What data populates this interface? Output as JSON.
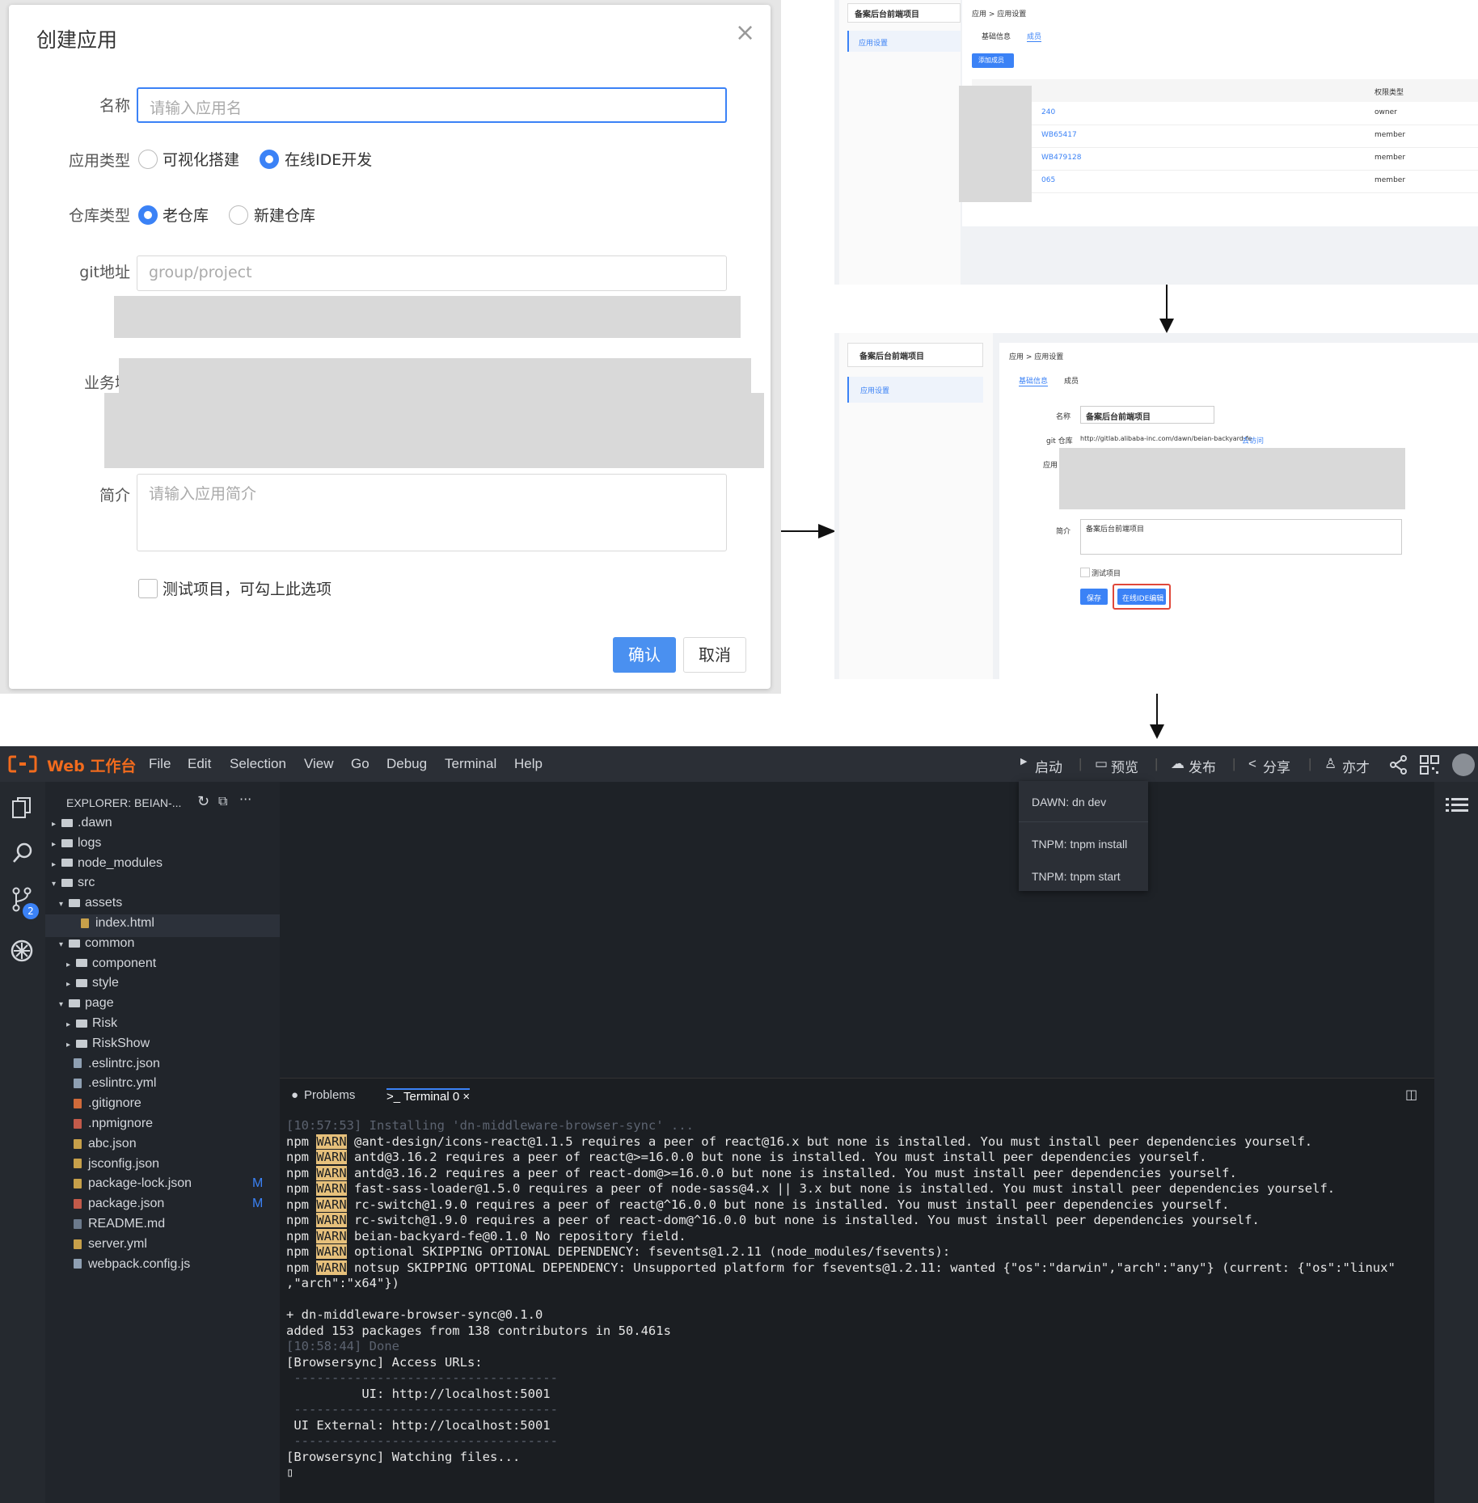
{
  "dialog": {
    "title": "创建应用",
    "close_glyph": "×",
    "name_label": "名称",
    "name_placeholder": "请输入应用名",
    "apptype_label": "应用类型",
    "apptype_options": [
      "可视化搭建",
      "在线IDE开发"
    ],
    "apptype_selected": "在线IDE开发",
    "repotype_label": "仓库类型",
    "repotype_options": [
      "老仓库",
      "新建仓库"
    ],
    "repotype_selected": "老仓库",
    "git_label": "git地址",
    "git_placeholder": "group/project",
    "domain_label": "业务域",
    "intro_label": "简介",
    "intro_placeholder": "请输入应用简介",
    "test_checkbox_label": "测试项目，可勾上此选项",
    "confirm_label": "确认",
    "cancel_label": "取消"
  },
  "shot_members": {
    "project_select": "备案后台前端项目",
    "sidebar_item": "应用设置",
    "breadcrumb": "应用 > 应用设置",
    "tabs": [
      "基础信息",
      "成员"
    ],
    "add_member_button": "添加成员",
    "table_header_role": "权限类型",
    "rows": [
      {
        "name": "240",
        "role": "owner"
      },
      {
        "name": "WB65417",
        "role": "member"
      },
      {
        "name": "WB479128",
        "role": "member"
      },
      {
        "name": "065",
        "role": "member"
      }
    ]
  },
  "shot_settings": {
    "project_select": "备案后台前端项目",
    "sidebar_item": "应用设置",
    "breadcrumb": "应用 > 应用设置",
    "tabs": [
      "基础信息",
      "成员"
    ],
    "name_label": "名称",
    "name_value": "备案后台前端项目",
    "git_label": "git 仓库",
    "git_value": "http://gitlab.alibaba-inc.com/dawn/beian-backyard-fe",
    "git_link": "去访问",
    "app_label": "应用",
    "intro_label": "简介",
    "intro_value": "备案后台前端项目",
    "test_label": "测试项目",
    "save_button": "保存",
    "ide_button": "在线IDE编辑"
  },
  "ide": {
    "brand": "Web 工作台",
    "menus": [
      "File",
      "Edit",
      "Selection",
      "View",
      "Go",
      "Debug",
      "Terminal",
      "Help"
    ],
    "toolbar": {
      "start": "启动",
      "preview": "预览",
      "publish": "发布",
      "share": "分享",
      "user": "亦才"
    },
    "explorer_title": "EXPLORER: BEIAN-...",
    "scm_badge": "2",
    "tree": [
      {
        "name": ".dawn",
        "type": "folder",
        "level": 0,
        "open": false
      },
      {
        "name": "logs",
        "type": "folder",
        "level": 0,
        "open": false
      },
      {
        "name": "node_modules",
        "type": "folder",
        "level": 0,
        "open": false
      },
      {
        "name": "src",
        "type": "folder",
        "level": 0,
        "open": true
      },
      {
        "name": "assets",
        "type": "folder",
        "level": 1,
        "open": true
      },
      {
        "name": "index.html",
        "type": "file",
        "level": 2,
        "open": false
      },
      {
        "name": "common",
        "type": "folder",
        "level": 1,
        "open": true
      },
      {
        "name": "component",
        "type": "folder",
        "level": 2,
        "open": false
      },
      {
        "name": "style",
        "type": "folder",
        "level": 2,
        "open": false
      },
      {
        "name": "page",
        "type": "folder",
        "level": 1,
        "open": true
      },
      {
        "name": "Risk",
        "type": "folder",
        "level": 2,
        "open": false
      },
      {
        "name": "RiskShow",
        "type": "folder",
        "level": 2,
        "open": false
      },
      {
        "name": ".eslintrc.json",
        "type": "file",
        "level": 1,
        "open": false
      },
      {
        "name": ".eslintrc.yml",
        "type": "file",
        "level": 1,
        "open": false
      },
      {
        "name": ".gitignore",
        "type": "file",
        "level": 1,
        "open": false
      },
      {
        "name": ".npmignore",
        "type": "file",
        "level": 1,
        "open": false
      },
      {
        "name": "abc.json",
        "type": "file",
        "level": 1,
        "open": false
      },
      {
        "name": "jsconfig.json",
        "type": "file",
        "level": 1,
        "open": false
      },
      {
        "name": "package-lock.json",
        "type": "file",
        "level": 1,
        "open": false,
        "status": "M"
      },
      {
        "name": "package.json",
        "type": "file",
        "level": 1,
        "open": false,
        "status": "M"
      },
      {
        "name": "README.md",
        "type": "file",
        "level": 1,
        "open": false
      },
      {
        "name": "server.yml",
        "type": "file",
        "level": 1,
        "open": false
      },
      {
        "name": "webpack.config.js",
        "type": "file",
        "level": 1,
        "open": false
      }
    ],
    "dropdown": [
      "DAWN: dn dev",
      "TNPM: tnpm install",
      "TNPM: tnpm start"
    ],
    "panel_tabs": {
      "problems": "Problems",
      "terminal": ">_ Terminal 0 ×"
    },
    "terminal_lines": [
      {
        "kind": "dim",
        "text": "[10:57:53] Installing 'dn-middleware-browser-sync' ..."
      },
      {
        "kind": "warn",
        "prefix": "npm ",
        "tag": "WARN",
        "text": " @ant-design/icons-react@1.1.5 requires a peer of react@16.x but none is installed. You must install peer dependencies yourself."
      },
      {
        "kind": "warn",
        "prefix": "npm ",
        "tag": "WARN",
        "text": " antd@3.16.2 requires a peer of react@>=16.0.0 but none is installed. You must install peer dependencies yourself."
      },
      {
        "kind": "warn",
        "prefix": "npm ",
        "tag": "WARN",
        "text": " antd@3.16.2 requires a peer of react-dom@>=16.0.0 but none is installed. You must install peer dependencies yourself."
      },
      {
        "kind": "warn",
        "prefix": "npm ",
        "tag": "WARN",
        "text": " fast-sass-loader@1.5.0 requires a peer of node-sass@4.x || 3.x but none is installed. You must install peer dependencies yourself."
      },
      {
        "kind": "warn",
        "prefix": "npm ",
        "tag": "WARN",
        "text": " rc-switch@1.9.0 requires a peer of react@^16.0.0 but none is installed. You must install peer dependencies yourself."
      },
      {
        "kind": "warn",
        "prefix": "npm ",
        "tag": "WARN",
        "text": " rc-switch@1.9.0 requires a peer of react-dom@^16.0.0 but none is installed. You must install peer dependencies yourself."
      },
      {
        "kind": "warn",
        "prefix": "npm ",
        "tag": "WARN",
        "text": " beian-backyard-fe@0.1.0 No repository field."
      },
      {
        "kind": "warn",
        "prefix": "npm ",
        "tag": "WARN",
        "text": " optional SKIPPING OPTIONAL DEPENDENCY: fsevents@1.2.11 (node_modules/fsevents):"
      },
      {
        "kind": "warn",
        "prefix": "npm ",
        "tag": "WARN",
        "text": " notsup SKIPPING OPTIONAL DEPENDENCY: Unsupported platform for fsevents@1.2.11: wanted {\"os\":\"darwin\",\"arch\":\"any\"} (current: {\"os\":\"linux\""
      },
      {
        "kind": "plain",
        "text": ",\"arch\":\"x64\"})"
      },
      {
        "kind": "plain",
        "text": ""
      },
      {
        "kind": "plain",
        "text": "+ dn-middleware-browser-sync@0.1.0"
      },
      {
        "kind": "plain",
        "text": "added 153 packages from 138 contributors in 50.461s"
      },
      {
        "kind": "dim",
        "text": "[10:58:44] Done"
      },
      {
        "kind": "plain",
        "text": "[Browsersync] Access URLs:"
      },
      {
        "kind": "dim",
        "text": " -----------------------------------"
      },
      {
        "kind": "plain",
        "text": "          UI: http://localhost:5001"
      },
      {
        "kind": "dim",
        "text": " -----------------------------------"
      },
      {
        "kind": "plain",
        "text": " UI External: http://localhost:5001"
      },
      {
        "kind": "dim",
        "text": " -----------------------------------"
      },
      {
        "kind": "plain",
        "text": "[Browsersync] Watching files..."
      },
      {
        "kind": "plain",
        "text": "▯"
      }
    ]
  },
  "colors": {
    "primary": "#4a90f0",
    "warn_bg": "#e6c07b",
    "brand": "#f26b1d",
    "highlight_border": "#e0483a"
  }
}
